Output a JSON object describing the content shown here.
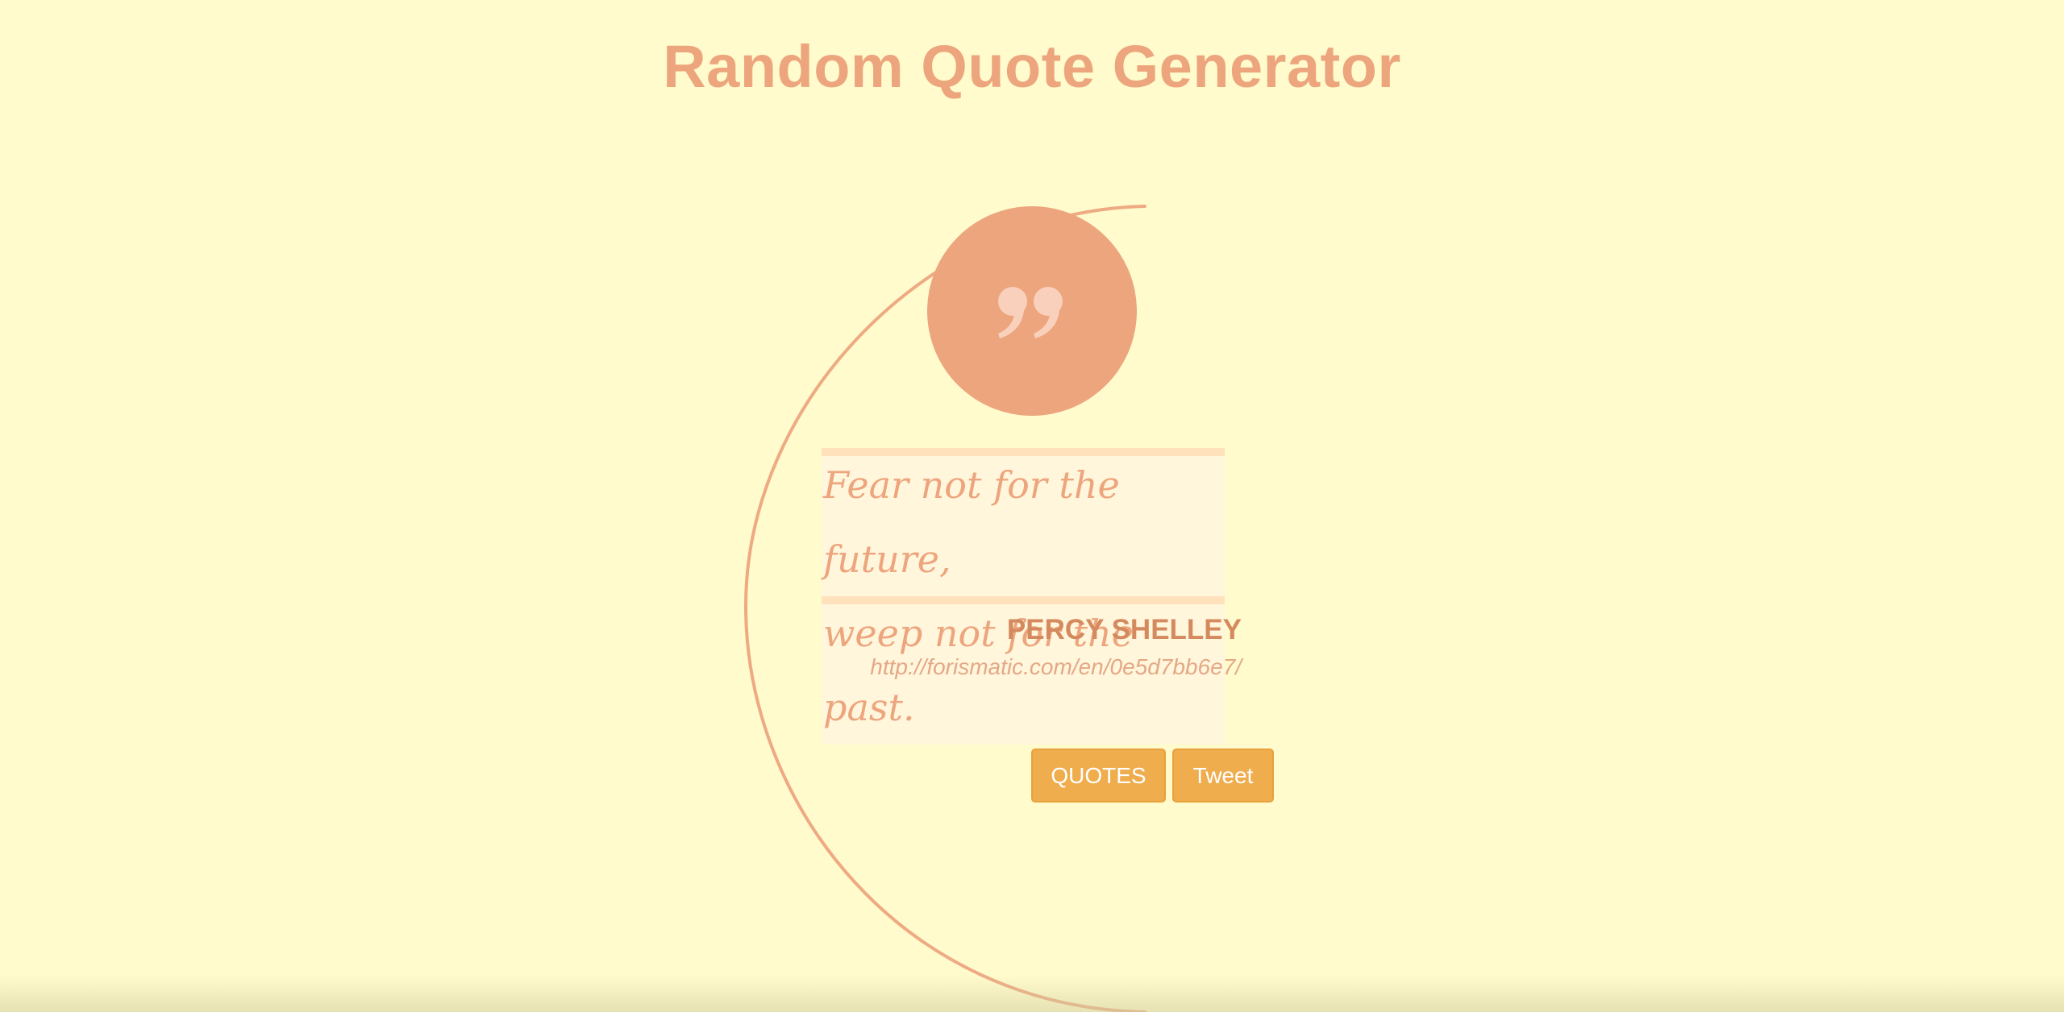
{
  "header": {
    "title": "Random Quote Generator"
  },
  "quote": {
    "icon": "quote-mark-icon",
    "line1": "Fear not for the future,",
    "line2": "weep not for the past.",
    "author": "PERCY SHELLEY",
    "link": "http://forismatic.com/en/0e5d7bb6e7/"
  },
  "actions": {
    "quotes_label": "QUOTES",
    "tweet_label": "Tweet"
  },
  "colors": {
    "background": "#fffbcc",
    "accent": "#eda57d",
    "button": "#efad4e"
  }
}
